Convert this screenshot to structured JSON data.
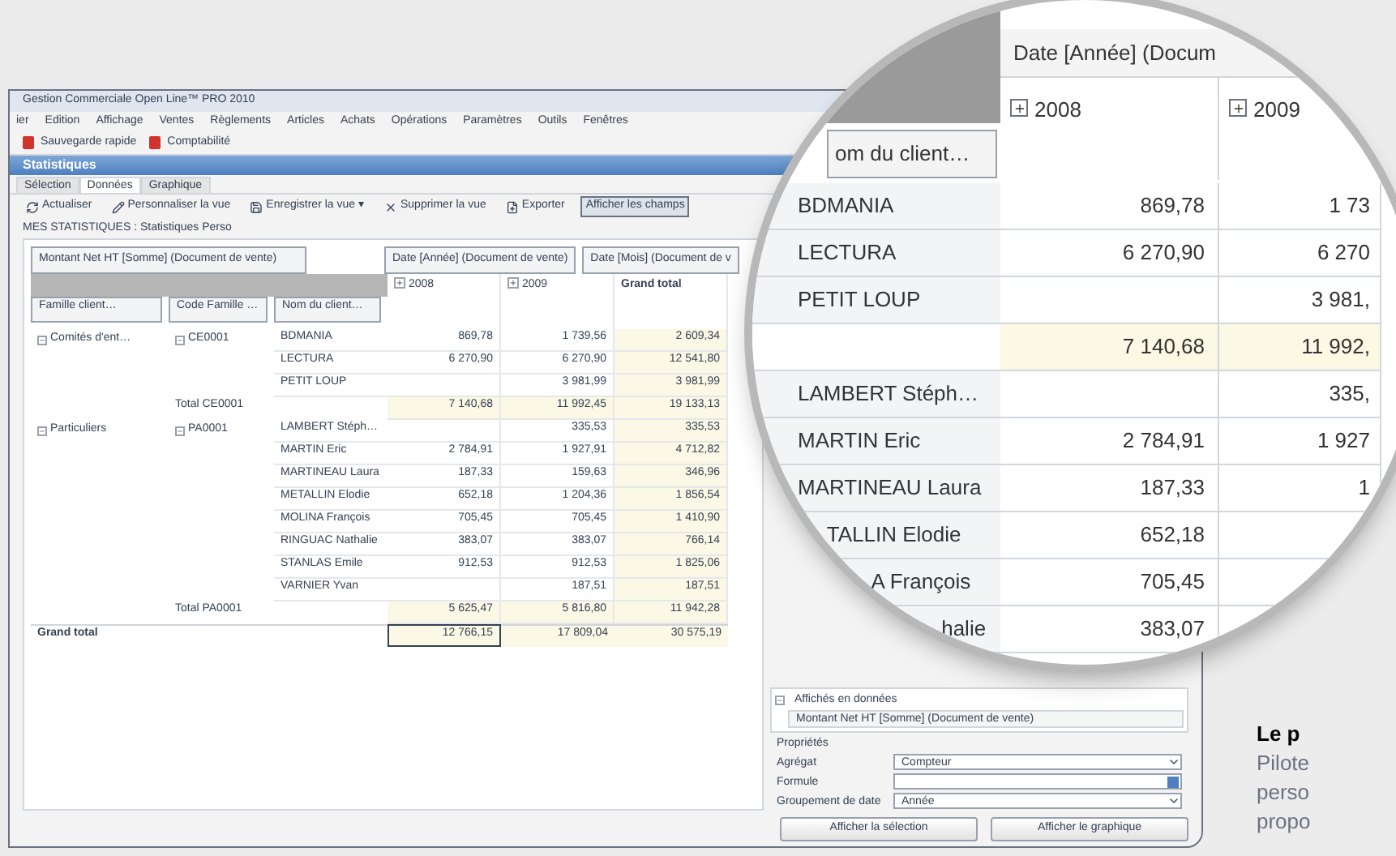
{
  "window": {
    "title": "Gestion Commerciale Open Line™ PRO 2010",
    "menu": [
      "ier",
      "Edition",
      "Affichage",
      "Ventes",
      "Règlements",
      "Articles",
      "Achats",
      "Opérations",
      "Paramètres",
      "Outils",
      "Fenêtres"
    ],
    "toolbar": [
      "Sauvegarde rapide",
      "Comptabilité"
    ],
    "panel_title": "Statistiques",
    "tabs": [
      {
        "label": "Sélection",
        "selected": false
      },
      {
        "label": "Données",
        "selected": true
      },
      {
        "label": "Graphique",
        "selected": false
      }
    ],
    "actions": [
      {
        "label": "Actualiser",
        "pressed": false
      },
      {
        "label": "Personnaliser la vue",
        "pressed": false
      },
      {
        "label": "Enregistrer la vue ▾",
        "pressed": false
      },
      {
        "label": "Supprimer la vue",
        "pressed": false
      },
      {
        "label": "Exporter",
        "pressed": false
      },
      {
        "label": "Afficher les champs",
        "pressed": true
      }
    ],
    "view_label": "MES STATISTIQUES : Statistiques Perso",
    "pivot": {
      "data_field": "Montant Net HT [Somme] (Document de vente)",
      "column_fields": [
        "Date [Année] (Document de vente)",
        "Date [Mois] (Document de v"
      ],
      "row_fields": [
        "Famille client…",
        "Code Famille …",
        "Nom du client…"
      ],
      "column_headers": [
        {
          "label": "2008",
          "expandable": true
        },
        {
          "label": "2009",
          "expandable": true
        },
        {
          "label": "Grand total",
          "expandable": false
        }
      ],
      "groups": [
        {
          "family": "Comités d'ent…",
          "code": "CE0001",
          "total_label": "Total CE0001",
          "total": {
            "v2008": "7 140,68",
            "v2009": "11 992,45",
            "grand_total": "19 133,13"
          },
          "rows": [
            {
              "name": "BDMANIA",
              "v2008": "869,78",
              "v2009": "1 739,56",
              "grand_total": "2 609,34"
            },
            {
              "name": "LECTURA",
              "v2008": "6 270,90",
              "v2009": "6 270,90",
              "grand_total": "12 541,80"
            },
            {
              "name": "PETIT LOUP",
              "v2009": "3 981,99",
              "grand_total": "3 981,99"
            }
          ]
        },
        {
          "family": "Particuliers",
          "code": "PA0001",
          "total_label": "Total PA0001",
          "total": {
            "v2008": "5 625,47",
            "v2009": "5 816,80",
            "grand_total": "11 942,28"
          },
          "rows": [
            {
              "name": "LAMBERT Stéph…",
              "v2009": "335,53",
              "grand_total": "335,53"
            },
            {
              "name": "MARTIN Eric",
              "v2008": "2 784,91",
              "v2009": "1 927,91",
              "grand_total": "4 712,82"
            },
            {
              "name": "MARTINEAU Laura",
              "v2008": "187,33",
              "v2009": "159,63",
              "grand_total": "346,96"
            },
            {
              "name": "METALLIN Elodie",
              "v2008": "652,18",
              "v2009": "1 204,36",
              "grand_total": "1 856,54"
            },
            {
              "name": "MOLINA François",
              "v2008": "705,45",
              "v2009": "705,45",
              "grand_total": "1 410,90"
            },
            {
              "name": "RINGUAC Nathalie",
              "v2008": "383,07",
              "v2009": "383,07",
              "grand_total": "766,14"
            },
            {
              "name": "STANLAS Emile",
              "v2008": "912,53",
              "v2009": "912,53",
              "grand_total": "1 825,06"
            },
            {
              "name": "VARNIER Yvan",
              "v2009": "187,51",
              "grand_total": "187,51"
            }
          ]
        }
      ],
      "grand_total_label": "Grand total",
      "grand_total": {
        "v2008": "12 766,15",
        "v2009": "17 809,04",
        "grand_total": "30 575,19"
      }
    },
    "field_list": [
      {
        "label": "Affichés en données",
        "kind": "section"
      },
      {
        "label": "Montant Net HT [Somme] (Document de vente)",
        "kind": "field"
      }
    ],
    "properties": {
      "title": "Propriétés",
      "fields": [
        {
          "label": "Agrégat",
          "value": "Compteur",
          "kind": "dropdown"
        },
        {
          "label": "Formule",
          "kind": "picker"
        },
        {
          "label": "Groupement de date",
          "value": "Année",
          "kind": "dropdown"
        }
      ]
    },
    "buttons": [
      "Afficher la sélection",
      "Afficher le graphique"
    ]
  },
  "magnifier": {
    "column_field": "Date [Année] (Docum",
    "column_headers": [
      "2008",
      "2009"
    ],
    "row_field": "om du client…",
    "rows": [
      {
        "name": "BDMANIA",
        "v2008": "869,78",
        "v2009": "1 73",
        "kind": "row"
      },
      {
        "name": "LECTURA",
        "v2008": "6 270,90",
        "v2009": "6 270",
        "kind": "row"
      },
      {
        "name": "PETIT LOUP",
        "v2009": "3 981,",
        "kind": "row"
      },
      {
        "v2008": "7 140,68",
        "v2009": "11 992,",
        "kind": "total"
      },
      {
        "name": "LAMBERT Stéph…",
        "v2009": "335,",
        "kind": "row"
      },
      {
        "name": "MARTIN Eric",
        "v2008": "2 784,91",
        "v2009": "1 927",
        "kind": "row"
      },
      {
        "name": "MARTINEAU Laura",
        "v2008": "187,33",
        "v2009": "1",
        "kind": "row"
      },
      {
        "name": "TALLIN Elodie",
        "v2008": "652,18",
        "kind": "row"
      },
      {
        "name": "A François",
        "v2008": "705,45",
        "kind": "row"
      },
      {
        "name": "halie",
        "v2008": "383,07",
        "kind": "row"
      }
    ]
  },
  "caption": {
    "heading": "Le p",
    "lines": [
      "Pilote",
      "perso",
      "propo"
    ]
  }
}
